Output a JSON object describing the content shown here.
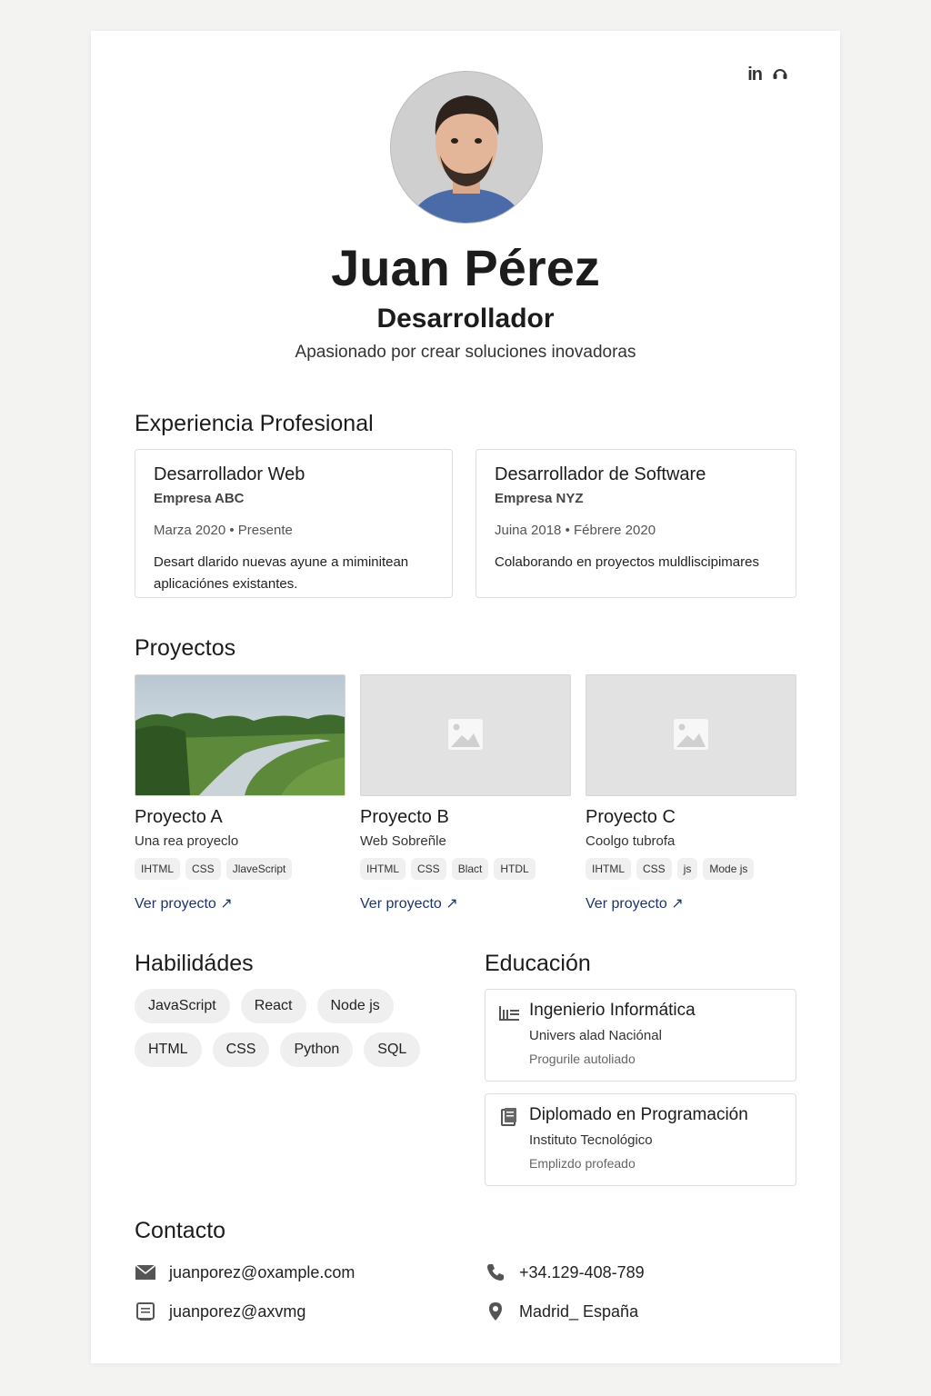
{
  "profile": {
    "name": "Juan Pérez",
    "role": "Desarrollador",
    "tagline": "Apasionado por crear soluciones inovadoras",
    "social_linkedin": "in"
  },
  "sections": {
    "experience": "Experiencia Profesional",
    "projects": "Proyectos",
    "skills": "Habilidádes",
    "education": "Educación",
    "contact": "Contacto"
  },
  "experience": [
    {
      "title": "Desarrollador Web",
      "company": "Empresa ABC",
      "dates": "Marza 2020 • Presente",
      "description": "Desart dlarido nuevas ayune a miminitean aplicaciónes existantes."
    },
    {
      "title": "Desarrollador de Software",
      "company": "Empresa NYZ",
      "dates": "Juina 2018 • Fébrere 2020",
      "description": "Colaborando en proyectos muldliscipimares"
    }
  ],
  "projects": [
    {
      "title": "Proyecto A",
      "subtitle": "Una rea proyeclo",
      "tags": [
        "IHTML",
        "CSS",
        "JlaveScript"
      ],
      "link": "Ver proyecto ↗",
      "image": "river-landscape"
    },
    {
      "title": "Proyecto B",
      "subtitle": "Web Sobreñle",
      "tags": [
        "IHTML",
        "CSS",
        "Blact",
        "HTDL"
      ],
      "link": "Ver proyecto ↗",
      "image": "placeholder-image-icon"
    },
    {
      "title": "Proyecto C",
      "subtitle": "Coolgo tubrofa",
      "tags": [
        "IHTML",
        "CSS",
        "js",
        "Mode js"
      ],
      "link": "Ver proyecto ↗",
      "image": "placeholder-image-icon"
    }
  ],
  "skills": [
    "JavaScript",
    "React",
    "Node js",
    "HTML",
    "CSS",
    "Python",
    "SQL"
  ],
  "education": [
    {
      "icon": "graduation-building-icon",
      "title": "Ingenierio Informática",
      "institution": "Univers alad Naciónal",
      "note": "Progurile autoliado"
    },
    {
      "icon": "book-icon",
      "title": "Diplomado en Programación",
      "institution": "Instituto Tecnológico",
      "note": "Emplizdo profeado"
    }
  ],
  "contact": {
    "email": "juanporez@oxample.com",
    "handle": "juanporez@axvmg",
    "phone": "+34.129-408-789",
    "location": "Madrid_ España"
  },
  "colors": {
    "link": "#1f3566",
    "background": "#f3f3f2",
    "card": "#ffffff"
  }
}
